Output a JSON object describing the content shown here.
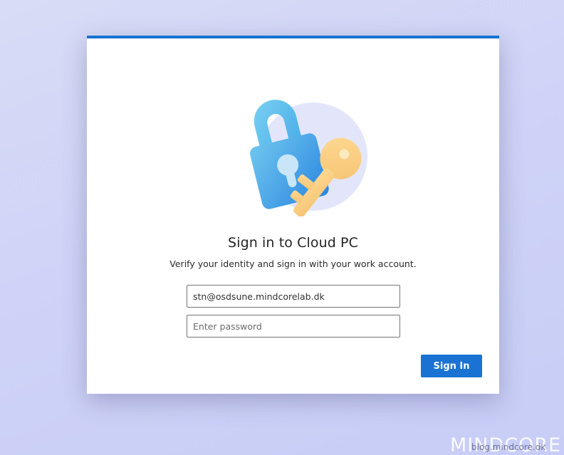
{
  "dialog": {
    "title": "Sign in to Cloud PC",
    "subtitle": "Verify your identity and sign in with your work account.",
    "email_value": "stn@osdsune.mindcorelab.dk",
    "password_placeholder": "Enter password",
    "signin_label": "Sign In",
    "accent_color": "#1673d1",
    "illustration": "lock-and-key-icon"
  },
  "watermark": {
    "logo_text": "MINDCORE",
    "tagline": "blog.mindcore.dk"
  },
  "colors": {
    "primary_button": "#1a73d2",
    "background": "#cfd3f7"
  }
}
